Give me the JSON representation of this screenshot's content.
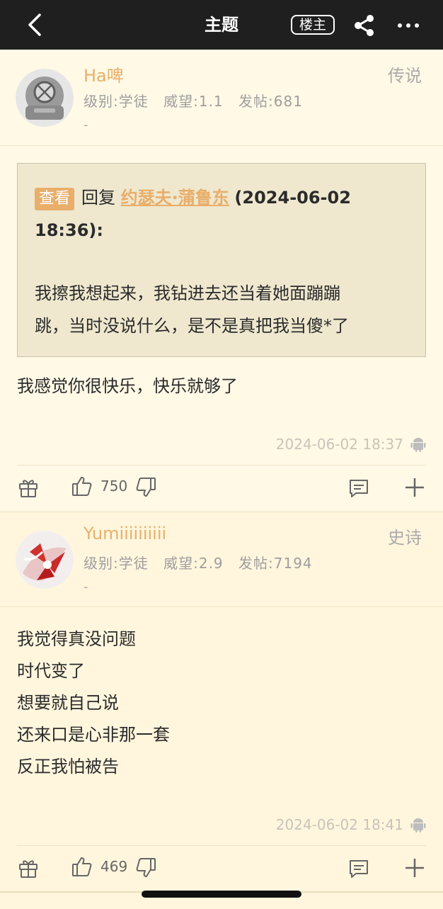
{
  "header": {
    "title": "主题",
    "op_label": "楼主"
  },
  "posts": [
    {
      "username": "Ha啤",
      "rank": "传说",
      "level": "级别:学徒",
      "prestige": "威望:1.1",
      "post_count": "发帖:681",
      "signature": "-",
      "quote": {
        "tag": "查看",
        "reply_word": "回复",
        "author": "约瑟夫·蒲鲁东",
        "time": "(2024-06-02 18:36):",
        "lines": [
          "我擦我想起来，我钻进去还当着她面蹦蹦",
          "跳，当时没说什么，是不是真把我当傻*了"
        ]
      },
      "content_lines": [
        "我感觉你很快乐，快乐就够了"
      ],
      "timestamp": "2024-06-02 18:37",
      "likes": "750"
    },
    {
      "username": "Yumiiiiiiiiii",
      "rank": "史诗",
      "level": "级别:学徒",
      "prestige": "威望:2.9",
      "post_count": "发帖:7194",
      "signature": "-",
      "content_lines": [
        "我觉得真没问题",
        "时代变了",
        "想要就自己说",
        "还来口是心非那一套",
        "反正我怕被告"
      ],
      "timestamp": "2024-06-02 18:41",
      "likes": "469"
    }
  ],
  "icons": [
    "back-arrow-icon",
    "share-icon",
    "more-icon",
    "gift-icon",
    "thumbs-up-icon",
    "thumbs-down-icon",
    "comment-icon",
    "plus-icon",
    "android-icon"
  ],
  "colors": {
    "header_bg": "#1f1f1f",
    "page_bg": "#fff9e6",
    "accent": "#e8ae6a",
    "quote_bg": "#efe8cf"
  }
}
